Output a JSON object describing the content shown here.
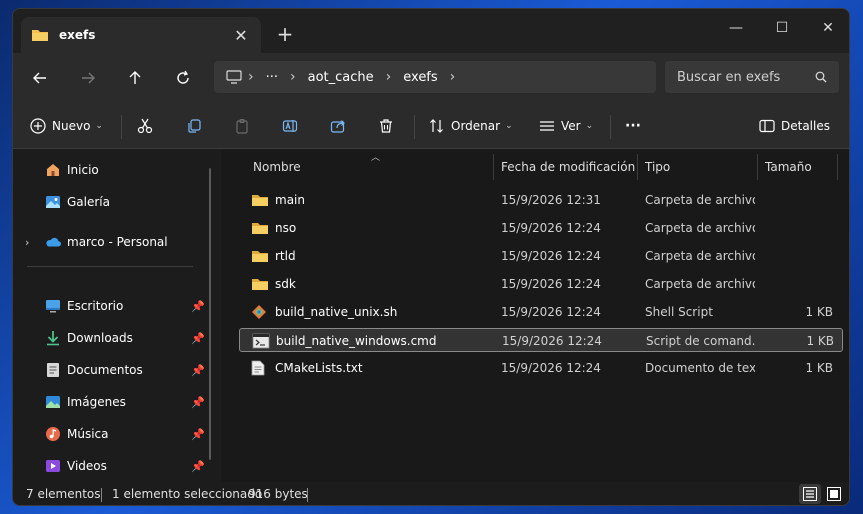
{
  "tab": {
    "title": "exefs",
    "close": "✕",
    "new_tab": "+"
  },
  "window_controls": {
    "minimize": "—",
    "maximize": "☐",
    "close": "✕"
  },
  "address": {
    "more": "···",
    "crumbs": [
      "aot_cache",
      "exefs"
    ],
    "sep": "›"
  },
  "search": {
    "placeholder": "Buscar en exefs"
  },
  "toolbar": {
    "new_label": "Nuevo",
    "sort_label": "Ordenar",
    "view_label": "Ver",
    "more": "···",
    "details_label": "Detalles"
  },
  "sidebar": {
    "items": [
      {
        "label": "Inicio",
        "icon": "home-icon",
        "pinned": false
      },
      {
        "label": "Galería",
        "icon": "gallery-icon",
        "pinned": false
      },
      {
        "label": "marco - Personal",
        "icon": "onedrive-icon",
        "pinned": false
      },
      {
        "label": "Escritorio",
        "icon": "desktop-icon",
        "pinned": true
      },
      {
        "label": "Downloads",
        "icon": "download-icon",
        "pinned": true
      },
      {
        "label": "Documentos",
        "icon": "documents-icon",
        "pinned": true
      },
      {
        "label": "Imágenes",
        "icon": "pictures-icon",
        "pinned": true
      },
      {
        "label": "Música",
        "icon": "music-icon",
        "pinned": true
      },
      {
        "label": "Videos",
        "icon": "videos-icon",
        "pinned": true
      }
    ]
  },
  "columns": {
    "name": "Nombre",
    "modified": "Fecha de modificación",
    "type": "Tipo",
    "size": "Tamaño"
  },
  "files": [
    {
      "name": "main",
      "modified": "15/9/2026 12:31",
      "type": "Carpeta de archivos",
      "size": "",
      "icon": "folder-icon"
    },
    {
      "name": "nso",
      "modified": "15/9/2026 12:24",
      "type": "Carpeta de archivos",
      "size": "",
      "icon": "folder-icon"
    },
    {
      "name": "rtld",
      "modified": "15/9/2026 12:24",
      "type": "Carpeta de archivos",
      "size": "",
      "icon": "folder-icon"
    },
    {
      "name": "sdk",
      "modified": "15/9/2026 12:24",
      "type": "Carpeta de archivos",
      "size": "",
      "icon": "folder-icon"
    },
    {
      "name": "build_native_unix.sh",
      "modified": "15/9/2026 12:24",
      "type": "Shell Script",
      "size": "1 KB",
      "icon": "shell-script-icon"
    },
    {
      "name": "build_native_windows.cmd",
      "modified": "15/9/2026 12:24",
      "type": "Script de comand...",
      "size": "1 KB",
      "icon": "cmd-script-icon",
      "selected": true
    },
    {
      "name": "CMakeLists.txt",
      "modified": "15/9/2026 12:24",
      "type": "Documento de tex...",
      "size": "1 KB",
      "icon": "text-file-icon"
    }
  ],
  "status": {
    "count": "7 elementos",
    "selection": "1 elemento seleccionado",
    "size": "916 bytes"
  },
  "colors": {
    "folder": "#f2c14e",
    "accent": "#4aa3f0"
  }
}
